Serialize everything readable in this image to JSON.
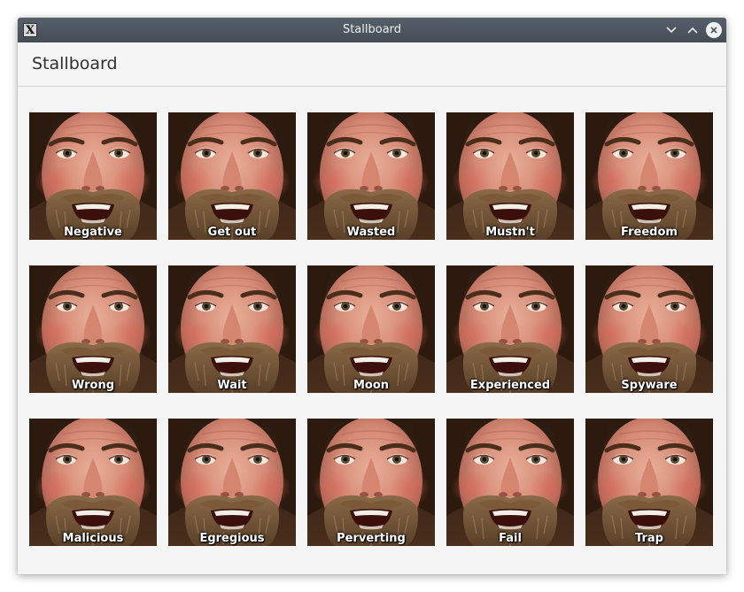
{
  "window": {
    "title": "Stallboard",
    "controls": [
      "minimize-icon",
      "maximize-icon",
      "close-icon"
    ]
  },
  "header": {
    "title": "Stallboard"
  },
  "tiles": [
    {
      "label": "Negative"
    },
    {
      "label": "Get out"
    },
    {
      "label": "Wasted"
    },
    {
      "label": "Mustn't"
    },
    {
      "label": "Freedom"
    },
    {
      "label": "Wrong"
    },
    {
      "label": "Wait"
    },
    {
      "label": "Moon"
    },
    {
      "label": "Experienced"
    },
    {
      "label": "Spyware"
    },
    {
      "label": "Malicious"
    },
    {
      "label": "Egregious"
    },
    {
      "label": "Perverting"
    },
    {
      "label": "Fail"
    },
    {
      "label": "Trap"
    }
  ],
  "colors": {
    "titlebar": "#4b535c",
    "window_bg": "#f5f5f5",
    "label_text": "#ffffff"
  }
}
